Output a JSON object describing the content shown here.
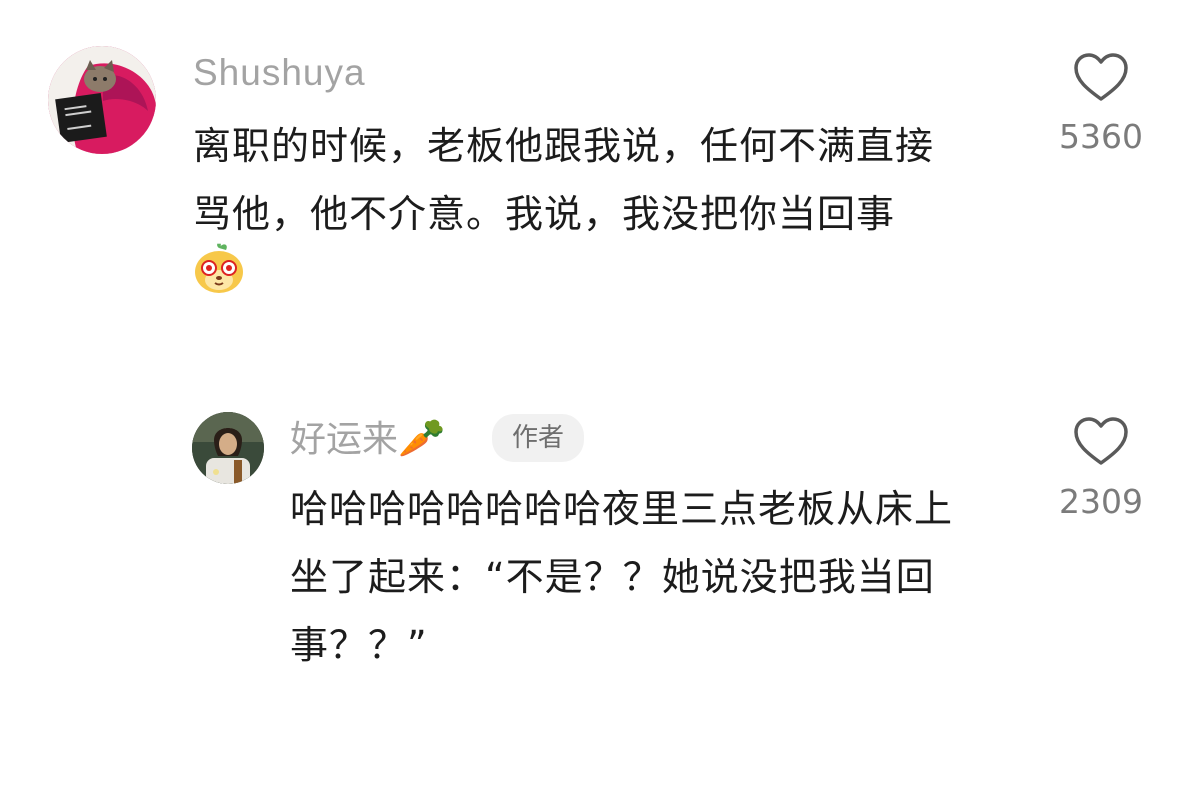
{
  "comments": [
    {
      "username": "Shushuya",
      "text": "离职的时候，老板他跟我说，任何不满直接\n骂他，他不介意。我说，我没把你当回事",
      "sticker": "puppy-emoji-sticker",
      "like_count": "5360",
      "like_icon": "heart-outline-icon"
    },
    {
      "username": "好运来",
      "username_emoji": "🥕",
      "author_badge": "作者",
      "text": "哈哈哈哈哈哈哈哈夜里三点老板从床上\n坐了起来：“不是？？她说没把我当回\n事？？”",
      "like_count": "2309",
      "like_icon": "heart-outline-icon"
    }
  ],
  "colors": {
    "username": "#a3a3a3",
    "text": "#1c1c1c",
    "like_count": "#7b7b7b",
    "badge_bg": "#f1f1f1"
  }
}
